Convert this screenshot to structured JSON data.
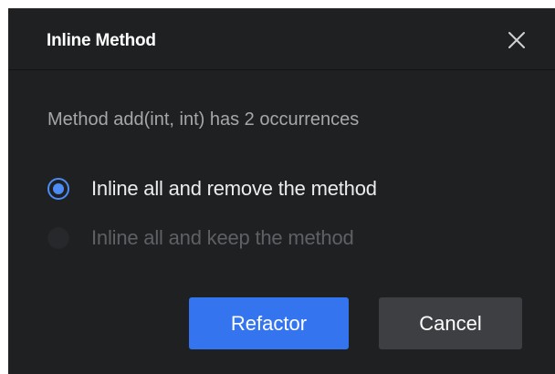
{
  "dialog": {
    "title": "Inline Method",
    "close_icon": "close-icon",
    "message": "Method add(int, int) has 2 occurrences",
    "options": [
      {
        "label": "Inline all and remove the method",
        "selected": true,
        "enabled": true
      },
      {
        "label": "Inline all and keep the method",
        "selected": false,
        "enabled": false
      }
    ],
    "buttons": {
      "primary_label": "Refactor",
      "secondary_label": "Cancel"
    }
  },
  "colors": {
    "background": "#1f2022",
    "accent": "#3474ef",
    "radio_accent": "#4d8bf5",
    "secondary_button": "#3e3f43"
  }
}
